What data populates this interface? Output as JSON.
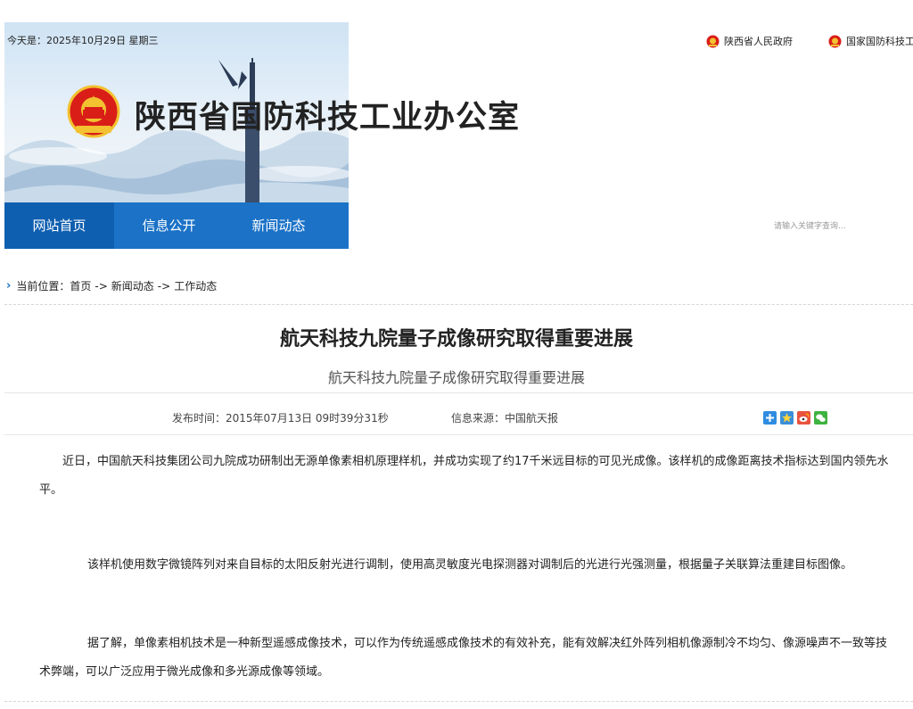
{
  "header": {
    "date_text": "今天是：2025年10月29日  星期三",
    "links": [
      {
        "label": "陕西省人民政府",
        "icon": "national-emblem-icon"
      },
      {
        "label": "国家国防科技工",
        "icon": "national-emblem-icon"
      }
    ],
    "site_title": "陕西省国防科技工业办公室",
    "emblem_icon": "national-emblem-icon"
  },
  "nav": {
    "items": [
      {
        "label": "网站首页",
        "active": true
      },
      {
        "label": "信息公开",
        "active": false
      },
      {
        "label": "新闻动态",
        "active": false
      }
    ]
  },
  "search": {
    "placeholder": "请输入关键字查询..."
  },
  "breadcrumb": {
    "prefix": "当前位置：",
    "items": [
      "首页",
      "新闻动态",
      "工作动态"
    ],
    "separator": "->"
  },
  "article": {
    "title": "航天科技九院量子成像研究取得重要进展",
    "subtitle": "航天科技九院量子成像研究取得重要进展",
    "publish_time": "发布时间：2015年07月13日 09时39分31秒",
    "source": "信息来源：中国航天报",
    "share_icons": [
      "share-plus-icon",
      "share-qzone-icon",
      "share-weibo-icon",
      "share-wechat-icon"
    ],
    "paragraphs": [
      "近日，中国航天科技集团公司九院成功研制出无源单像素相机原理样机，并成功实现了约17千米远目标的可见光成像。该样机的成像距离技术指标达到国内领先水平。",
      "该样机使用数字微镜阵列对来自目标的太阳反射光进行调制，使用高灵敏度光电探测器对调制后的光进行光强测量，根据量子关联算法重建目标图像。",
      "据了解，单像素相机技术是一种新型遥感成像技术，可以作为传统遥感成像技术的有效补充，能有效解决红外阵列相机像源制冷不均匀、像源噪声不一致等技术弊端，可以广泛应用于微光成像和多光源成像等领域。"
    ]
  },
  "colors": {
    "nav_blue": "#1b72c7",
    "nav_active": "#0f5fb0",
    "emblem_red": "#d91e18",
    "emblem_gold": "#f2c230"
  }
}
